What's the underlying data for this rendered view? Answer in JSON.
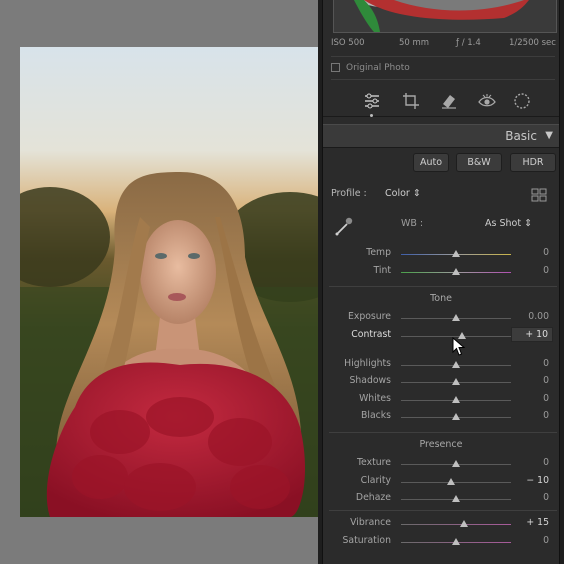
{
  "exif": {
    "iso": "ISO 500",
    "focal": "50 mm",
    "aperture": "ƒ / 1.4",
    "shutter": "1/2500 sec"
  },
  "original_photo_label": "Original Photo",
  "tools": [
    "edit-sliders-icon",
    "crop-icon",
    "healing-eraser-icon",
    "red-eye-icon",
    "mask-circle-icon"
  ],
  "panel": {
    "title": "Basic"
  },
  "treatment": {
    "auto": "Auto",
    "bw": "B&W",
    "hdr": "HDR"
  },
  "profile": {
    "label": "Profile :",
    "value": "Color ⇕"
  },
  "wb": {
    "label": "WB :",
    "value": "As Shot ⇕"
  },
  "sections": {
    "tone": "Tone",
    "presence": "Presence"
  },
  "sliders": {
    "temp": {
      "label": "Temp",
      "value": "0",
      "level": 0.5
    },
    "tint": {
      "label": "Tint",
      "value": "0",
      "level": 0.5
    },
    "exposure": {
      "label": "Exposure",
      "value": "0.00",
      "level": 0.5
    },
    "contrast": {
      "label": "Contrast",
      "value": "+ 10",
      "level": 0.55
    },
    "highlights": {
      "label": "Highlights",
      "value": "0",
      "level": 0.5
    },
    "shadows": {
      "label": "Shadows",
      "value": "0",
      "level": 0.5
    },
    "whites": {
      "label": "Whites",
      "value": "0",
      "level": 0.5
    },
    "blacks": {
      "label": "Blacks",
      "value": "0",
      "level": 0.5
    },
    "texture": {
      "label": "Texture",
      "value": "0",
      "level": 0.5
    },
    "clarity": {
      "label": "Clarity",
      "value": "− 10",
      "level": 0.45
    },
    "dehaze": {
      "label": "Dehaze",
      "value": "0",
      "level": 0.5
    },
    "vibrance": {
      "label": "Vibrance",
      "value": "+ 15",
      "level": 0.575
    },
    "saturation": {
      "label": "Saturation",
      "value": "0",
      "level": 0.5
    }
  },
  "colors": {
    "panel_bg": "#2b2b2b",
    "canvas_bg": "#7b7b7b",
    "dress": "#b0182f"
  }
}
